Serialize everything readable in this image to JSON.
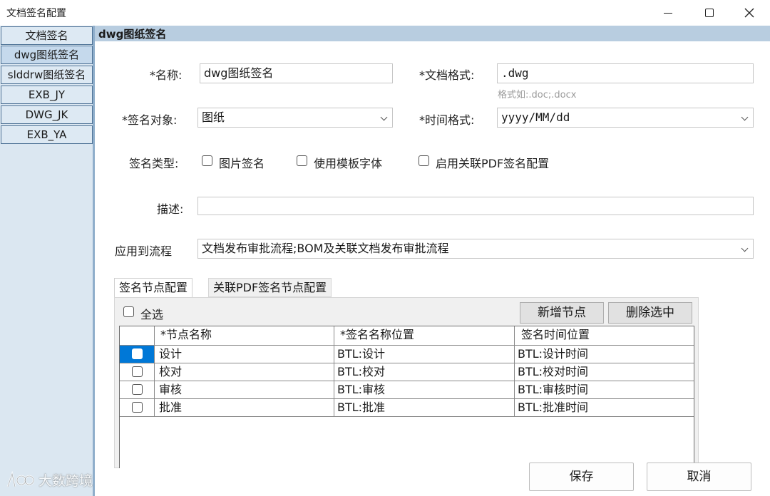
{
  "window": {
    "title": "文档签名配置"
  },
  "sidebar": {
    "items": [
      {
        "label": "文档签名"
      },
      {
        "label": "dwg图纸签名"
      },
      {
        "label": "slddrw图纸签名"
      },
      {
        "label": "EXB_JY"
      },
      {
        "label": "DWG_JK"
      },
      {
        "label": "EXB_YA"
      }
    ],
    "active_index": 1
  },
  "header": {
    "title": "dwg图纸签名"
  },
  "form": {
    "name_label": "*名称:",
    "name_value": "dwg图纸签名",
    "format_label": "*文档格式:",
    "format_value": ".dwg",
    "format_hint": "格式如:.doc;.docx",
    "target_label": "*签名对象:",
    "target_value": "图纸",
    "time_label": "*时间格式:",
    "time_value": "yyyy/MM/dd",
    "type_label": "签名类型:",
    "type_options": [
      {
        "label": "图片签名",
        "checked": false
      },
      {
        "label": "使用模板字体",
        "checked": false
      },
      {
        "label": "启用关联PDF签名配置",
        "checked": false
      }
    ],
    "desc_label": "描述:",
    "desc_value": "",
    "flow_label": "应用到流程",
    "flow_value": "文档发布审批流程;BOM及关联文档发布审批流程"
  },
  "tabs": [
    {
      "label": "签名节点配置",
      "active": true
    },
    {
      "label": "关联PDF签名节点配置",
      "active": false
    }
  ],
  "nodes": {
    "select_all_label": "全选",
    "add_label": "新增节点",
    "delete_label": "删除选中",
    "columns": [
      "*节点名称",
      "*签名名称位置",
      "签名时间位置"
    ],
    "rows": [
      {
        "name": "设计",
        "sign_pos": "BTL:设计",
        "time_pos": "BTL:设计时间",
        "checked": false
      },
      {
        "name": "校对",
        "sign_pos": "BTL:校对",
        "time_pos": "BTL:校对时间",
        "checked": false
      },
      {
        "name": "审核",
        "sign_pos": "BTL:审核",
        "time_pos": "BTL:审核时间",
        "checked": false
      },
      {
        "name": "批准",
        "sign_pos": "BTL:批准",
        "time_pos": "BTL:批准时间",
        "checked": false
      }
    ]
  },
  "actions": {
    "save_label": "保存",
    "cancel_label": "取消"
  },
  "watermark": {
    "text": "大数跨境"
  },
  "colors": {
    "sidebar_bg": "#dbe7f1",
    "header_bg": "#b8cde0",
    "row_selected": "#0078d7"
  }
}
